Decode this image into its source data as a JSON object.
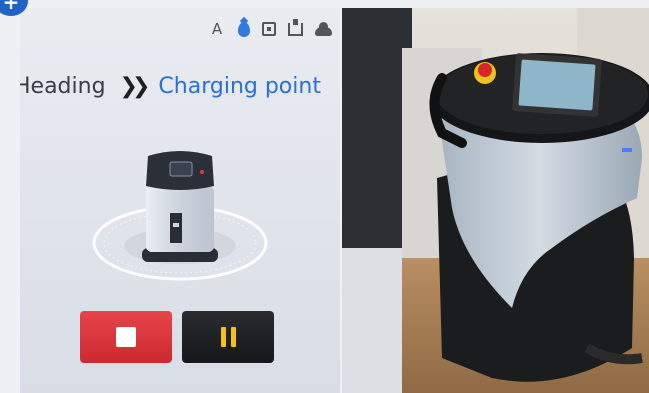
{
  "badge": {
    "symbol": "+"
  },
  "screen": {
    "status_icons": [
      {
        "name": "auto-mode-icon",
        "text": "A"
      },
      {
        "name": "water-drop-icon"
      },
      {
        "name": "box-icon"
      },
      {
        "name": "tray-icon"
      },
      {
        "name": "cloud-icon"
      }
    ],
    "route": {
      "from": "Heading",
      "to": "Charging point"
    }
  },
  "controls": {
    "stop_color": "#d9363c",
    "pause_color": "#1c1e21",
    "pause_icon_color": "#f1c21b"
  }
}
